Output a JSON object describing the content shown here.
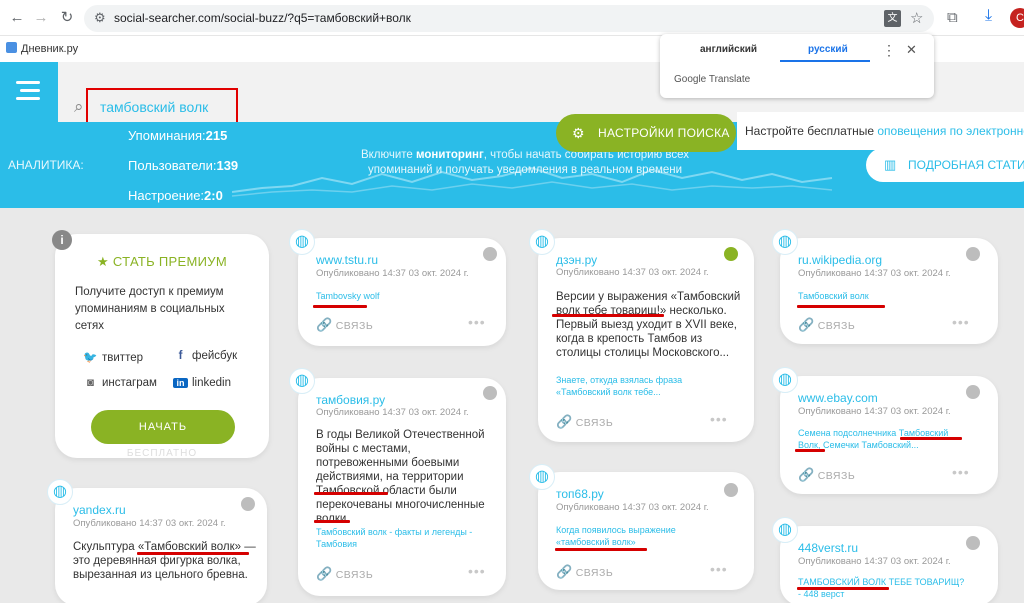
{
  "browser": {
    "url": "social-searcher.com/social-buzz/?q5=тамбовский+волк",
    "bookmark": "Дневник.ру",
    "profile_initial": "С"
  },
  "translate_popup": {
    "lang_from": "английский",
    "lang_to": "русский",
    "brand": "Google Translate"
  },
  "search": {
    "query": "тамбовский волк"
  },
  "analytics": {
    "label": "АНАЛИТИКА:",
    "mentions_label": "Упоминания:",
    "mentions_value": "215",
    "users_label": "Пользователи:",
    "users_value": "139",
    "sentiment_label": "Настроение:",
    "sentiment_value": "2:0",
    "promo_pre": "Включите ",
    "promo_bold": "мониторинг",
    "promo_post": ", чтобы начать собирать историю всех упоминаний и получать уведомления в реальном времени"
  },
  "settings_button": "НАСТРОЙКИ ПОИСКА",
  "alerts": {
    "text": "Настройте бесплатные ",
    "link": "оповещения по электронно"
  },
  "stats_button": "ПОДРОБНАЯ СТАТИС",
  "premium": {
    "title": "★ СТАТЬ ПРЕМИУМ",
    "desc": "Получите доступ к премиум упоминаниям в социальных сетях",
    "twitter": "твиттер",
    "facebook": "фейсбук",
    "instagram": "инстаграм",
    "linkedin": "linkedin",
    "button": "НАЧАТЬ",
    "free": "БЕСПЛАТНО"
  },
  "common": {
    "published": "Опубликовано 14:37 03 окт. 2024 г.",
    "link_label": "СВЯЗЬ"
  },
  "cards": {
    "tstu": {
      "site": "www.tstu.ru",
      "snippet": "Tambovsky wolf"
    },
    "tambovia": {
      "site": "тамбовия.ру",
      "body": "В годы Великой Отечественной войны с местами, потревоженными боевыми действиями, на территории Тамбовской области были перекочеваны многочисленные волки.",
      "snippet": "Тамбовский волк - факты и легенды - Тамбовия"
    },
    "dzen": {
      "site": "дзэн.ру",
      "body": "Версии у выражения «Тамбовский волк тебе товарищ!» несколько. Первый выезд уходит в XVII веке, когда в крепость Тамбов из столицы столицы Московского...",
      "snippet": "Знаете, откуда взялась фраза «Тамбовский волк тебе..."
    },
    "ton68": {
      "site": "топ68.ру",
      "snippet": "Когда появилось выражение «тамбовский волк»"
    },
    "wiki": {
      "site": "ru.wikipedia.org",
      "snippet": "Тамбовский волк"
    },
    "ebay": {
      "site": "www.ebay.com",
      "snippet": "Семена подсолнечника Тамбовский Волк, Семечки Тамбовский..."
    },
    "verst": {
      "site": "448verst.ru",
      "snippet": "ТАМБОВСКИЙ ВОЛК ТЕБЕ ТОВАРИЩ? - 448 верст"
    },
    "yandex": {
      "site": "yandex.ru",
      "body": "Скульптура «Тамбовский волк» — это деревянная фигурка волка, вырезанная из цельного бревна."
    }
  },
  "colors": {
    "accent_blue": "#2bbde8",
    "accent_green": "#8ab324",
    "annotation_red": "#d50000"
  }
}
